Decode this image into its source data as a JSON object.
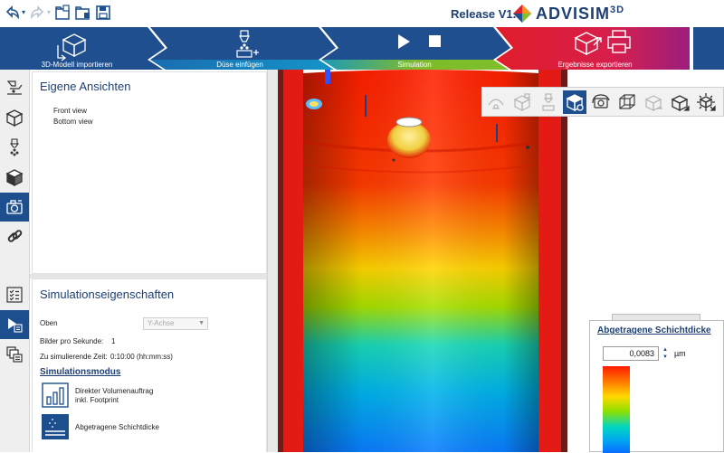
{
  "header": {
    "release": "Release V1.6",
    "brand": "ADVISIM",
    "brand_sup": "3D",
    "icons": [
      "undo-icon",
      "redo-icon",
      "open-folder-icon",
      "save-folder-icon",
      "save-icon"
    ]
  },
  "workflow": {
    "steps": [
      {
        "label": "3D-Modell importieren",
        "icon": "cube-import-icon"
      },
      {
        "label": "Düse einfügen",
        "icon": "nozzle-icon"
      },
      {
        "label": "Simulation",
        "icon": "play-stop-icon"
      },
      {
        "label": "Ergebnisse exportieren",
        "icon": "export-print-icon"
      }
    ],
    "colors": {
      "blue": "#1f4f8e",
      "teal": "#14a0c8",
      "green": "#7fbf2a",
      "red": "#e0202a",
      "magenta": "#a01e78"
    }
  },
  "left_toolbar": {
    "items": [
      "nozzle-path-icon",
      "cube-icon",
      "nozzle-spray-icon",
      "shaded-cube-icon",
      "camera-views-icon",
      "link-icon",
      "checklist-icon",
      "play-properties-icon",
      "layer-properties-icon"
    ],
    "active": [
      "camera-views-icon",
      "play-properties-icon"
    ]
  },
  "views_panel": {
    "title": "Eigene Ansichten",
    "items": [
      "Front view",
      "Bottom view"
    ]
  },
  "sim_panel": {
    "title": "Simulationseigenschaften",
    "oben_label": "Oben",
    "oben_value": "Y-Achse",
    "fps_label": "Bilder pro Sekunde:",
    "fps_value": "1",
    "time_label": "Zu simulierende Zeit:",
    "time_value": "0:10:00 (hh:mm:ss)",
    "mode_title": "Simulationsmodus",
    "mode_1": "Direkter Volumenauftrag inkl. Footprint",
    "mode_1a": "Direkter Volumenauftrag",
    "mode_1b": "inkl. Footprint",
    "mode_2": "Abgetragene Schichtdicke"
  },
  "view_toolbar": {
    "items": [
      "spray-path-icon",
      "nozzle-cube-icon",
      "nozzle-disabled-icon",
      "view-cube-active-icon",
      "rotate-camera-icon",
      "wireframe-cube-icon",
      "cube-arrow-icon",
      "cube-axes-icon",
      "cube-gear-icon"
    ]
  },
  "legend": {
    "title": "Abgetragene Schichtdicke",
    "value": "0,0083",
    "unit": "µm"
  },
  "accent": "#1d4f8f"
}
